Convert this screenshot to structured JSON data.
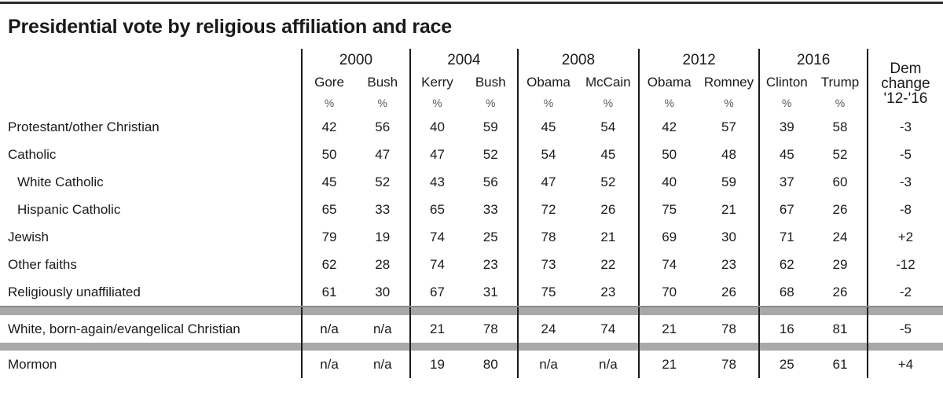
{
  "page_title": "Presidential vote by religious affiliation and race",
  "header": {
    "years": [
      "2000",
      "2004",
      "2008",
      "2012",
      "2016"
    ],
    "candidates": [
      "Gore",
      "Bush",
      "Kerry",
      "Bush",
      "Obama",
      "McCain",
      "Obama",
      "Romney",
      "Clinton",
      "Trump"
    ],
    "unit_symbols": [
      "%",
      "%",
      "%",
      "%",
      "%",
      "%",
      "%",
      "%",
      "%",
      "%"
    ],
    "dem_change_line1": "Dem",
    "dem_change_line2": "change",
    "dem_change_line3": "'12-'16"
  },
  "chart_data": {
    "type": "table",
    "title": "Presidential vote by religious affiliation and race",
    "column_groups": [
      "2000",
      "2004",
      "2008",
      "2012",
      "2016",
      "Dem change '12-'16"
    ],
    "columns": [
      "Gore",
      "Bush",
      "Kerry",
      "Bush",
      "Obama",
      "McCain",
      "Obama",
      "Romney",
      "Clinton",
      "Trump",
      "Dem change '12-'16"
    ],
    "units": "%",
    "rows": [
      {
        "label": "Protestant/other Christian",
        "indent": false,
        "values": [
          "42",
          "56",
          "40",
          "59",
          "45",
          "54",
          "42",
          "57",
          "39",
          "58"
        ],
        "dem_change": "-3"
      },
      {
        "label": "Catholic",
        "indent": false,
        "values": [
          "50",
          "47",
          "47",
          "52",
          "54",
          "45",
          "50",
          "48",
          "45",
          "52"
        ],
        "dem_change": "-5"
      },
      {
        "label": "White Catholic",
        "indent": true,
        "values": [
          "45",
          "52",
          "43",
          "56",
          "47",
          "52",
          "40",
          "59",
          "37",
          "60"
        ],
        "dem_change": "-3"
      },
      {
        "label": "Hispanic Catholic",
        "indent": true,
        "values": [
          "65",
          "33",
          "65",
          "33",
          "72",
          "26",
          "75",
          "21",
          "67",
          "26"
        ],
        "dem_change": "-8"
      },
      {
        "label": "Jewish",
        "indent": false,
        "values": [
          "79",
          "19",
          "74",
          "25",
          "78",
          "21",
          "69",
          "30",
          "71",
          "24"
        ],
        "dem_change": "+2"
      },
      {
        "label": "Other faiths",
        "indent": false,
        "values": [
          "62",
          "28",
          "74",
          "23",
          "73",
          "22",
          "74",
          "23",
          "62",
          "29"
        ],
        "dem_change": "-12"
      },
      {
        "label": "Religiously unaffiliated",
        "indent": false,
        "values": [
          "61",
          "30",
          "67",
          "31",
          "75",
          "23",
          "70",
          "26",
          "68",
          "26"
        ],
        "dem_change": "-2"
      },
      {
        "label": "White, born-again/evangelical Christian",
        "indent": false,
        "values": [
          "n/a",
          "n/a",
          "21",
          "78",
          "24",
          "74",
          "21",
          "78",
          "16",
          "81"
        ],
        "dem_change": "-5"
      },
      {
        "label": "Mormon",
        "indent": false,
        "values": [
          "n/a",
          "n/a",
          "19",
          "80",
          "n/a",
          "n/a",
          "21",
          "78",
          "25",
          "61"
        ],
        "dem_change": "+4"
      }
    ]
  },
  "colors": {
    "ink": "#1a1a1a",
    "rule_dark": "#2b2b2b",
    "rule_grey": "#8a8a8a",
    "band_grey": "#a8a8a8",
    "background": "#ffffff"
  }
}
